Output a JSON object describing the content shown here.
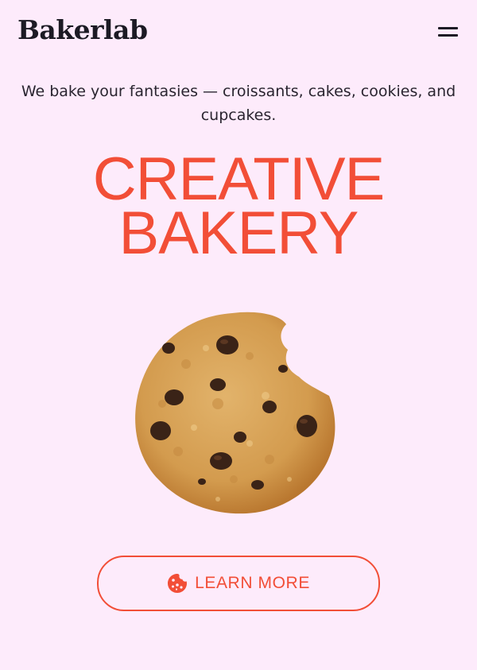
{
  "header": {
    "logo": "Bakerlab",
    "menu_icon": "hamburger-menu-icon"
  },
  "hero": {
    "tagline": "We bake your fantasies — croissants, cakes, cookies, and cupcakes.",
    "title_line1": "CREATIVE",
    "title_line2": "BAKERY",
    "image": "chocolate-chip-cookie"
  },
  "cta": {
    "label": "LEARN MORE",
    "icon": "cookie-icon"
  },
  "colors": {
    "background": "#fdebfb",
    "accent": "#f24e37",
    "text": "#1e1a22"
  }
}
